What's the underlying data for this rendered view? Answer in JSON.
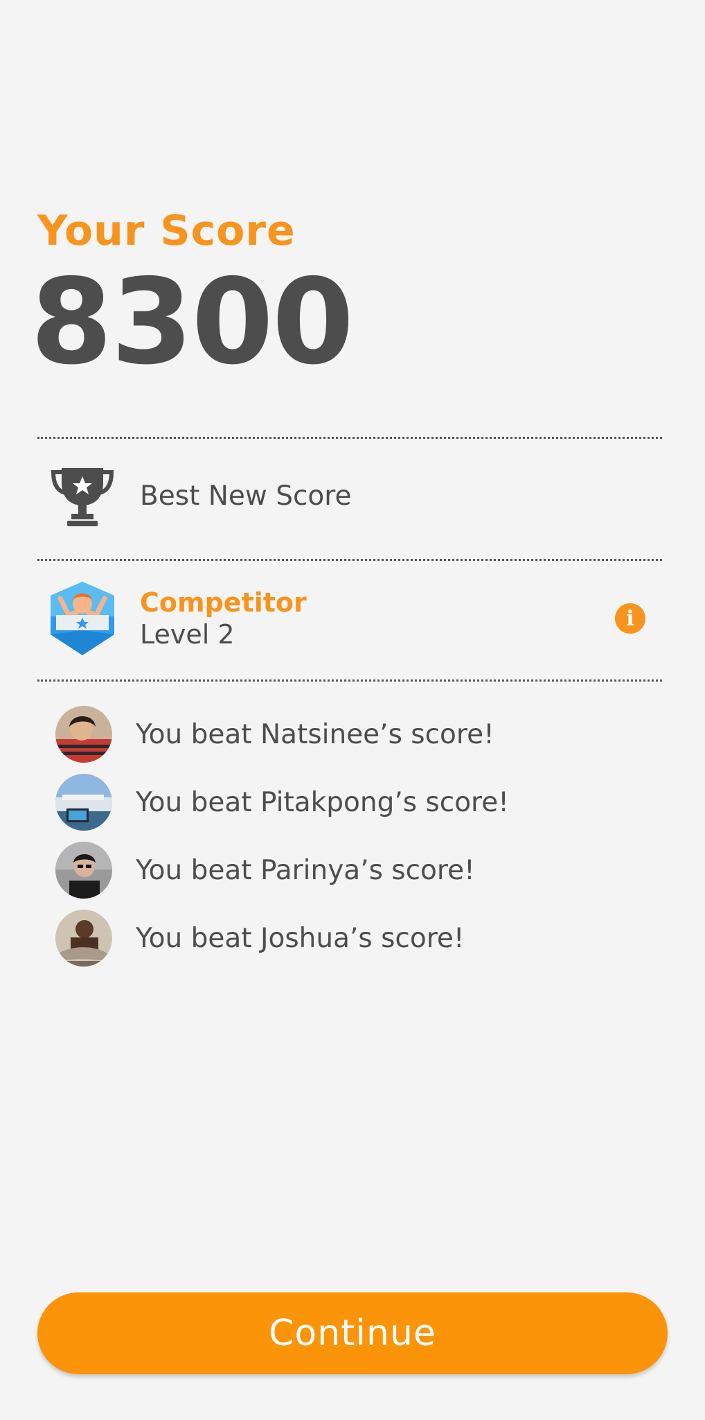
{
  "score": {
    "label": "Your Score",
    "value": "8300"
  },
  "best_score": {
    "text": "Best New Score",
    "icon": "trophy-icon"
  },
  "badge": {
    "title": "Competitor",
    "level": "Level 2",
    "icon": "competitor-badge-icon",
    "info_icon": "info-icon"
  },
  "beats": [
    {
      "text": "You beat Natsinee’s score!"
    },
    {
      "text": "You beat Pitakpong’s score!"
    },
    {
      "text": "You beat Parinya’s score!"
    },
    {
      "text": "You beat Joshua’s score!"
    }
  ],
  "continue_label": "Continue",
  "colors": {
    "accent": "#f7941d",
    "button": "#fb9409",
    "text": "#4d4d4d",
    "background": "#f4f4f4"
  }
}
